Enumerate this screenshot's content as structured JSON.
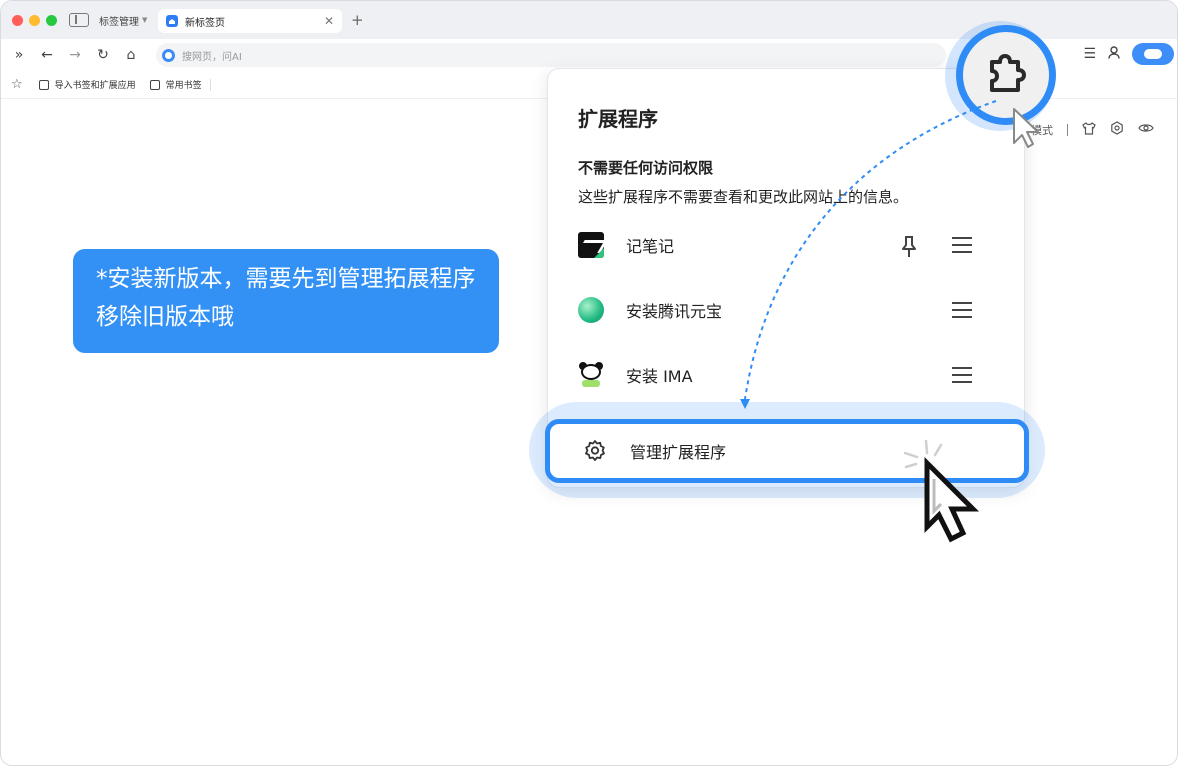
{
  "tabbar": {
    "tab_manager_label": "标签管理",
    "active_tab_label": "新标签页",
    "new_tab_symbol": "+"
  },
  "toolbar": {
    "omnibox_placeholder": "搜网页，问AI"
  },
  "bookmarks": {
    "items": [
      {
        "label": "导入书签和扩展应用",
        "icon": "import-icon"
      },
      {
        "label": "常用书签",
        "icon": "bookmark-icon"
      }
    ]
  },
  "page_tools": {
    "mode_label": "模式"
  },
  "callout": {
    "text": "*安装新版本，需要先到管理拓展程序移除旧版本哦"
  },
  "extensions_popup": {
    "title": "扩展程序",
    "section_title": "不需要任何访问权限",
    "section_desc": "这些扩展程序不需要查看和更改此网站上的信息。",
    "items": [
      {
        "name": "记笔记",
        "icon": "notes-logo-icon",
        "pinned": true
      },
      {
        "name": "安装腾讯元宝",
        "icon": "yuanbao-logo-icon",
        "pinned": false
      },
      {
        "name": "安装 IMA",
        "icon": "ima-panda-logo-icon",
        "pinned": false
      }
    ],
    "manage_label": "管理扩展程序"
  },
  "colors": {
    "accent": "#2f8cf6",
    "callout_bg": "#3391f5"
  }
}
